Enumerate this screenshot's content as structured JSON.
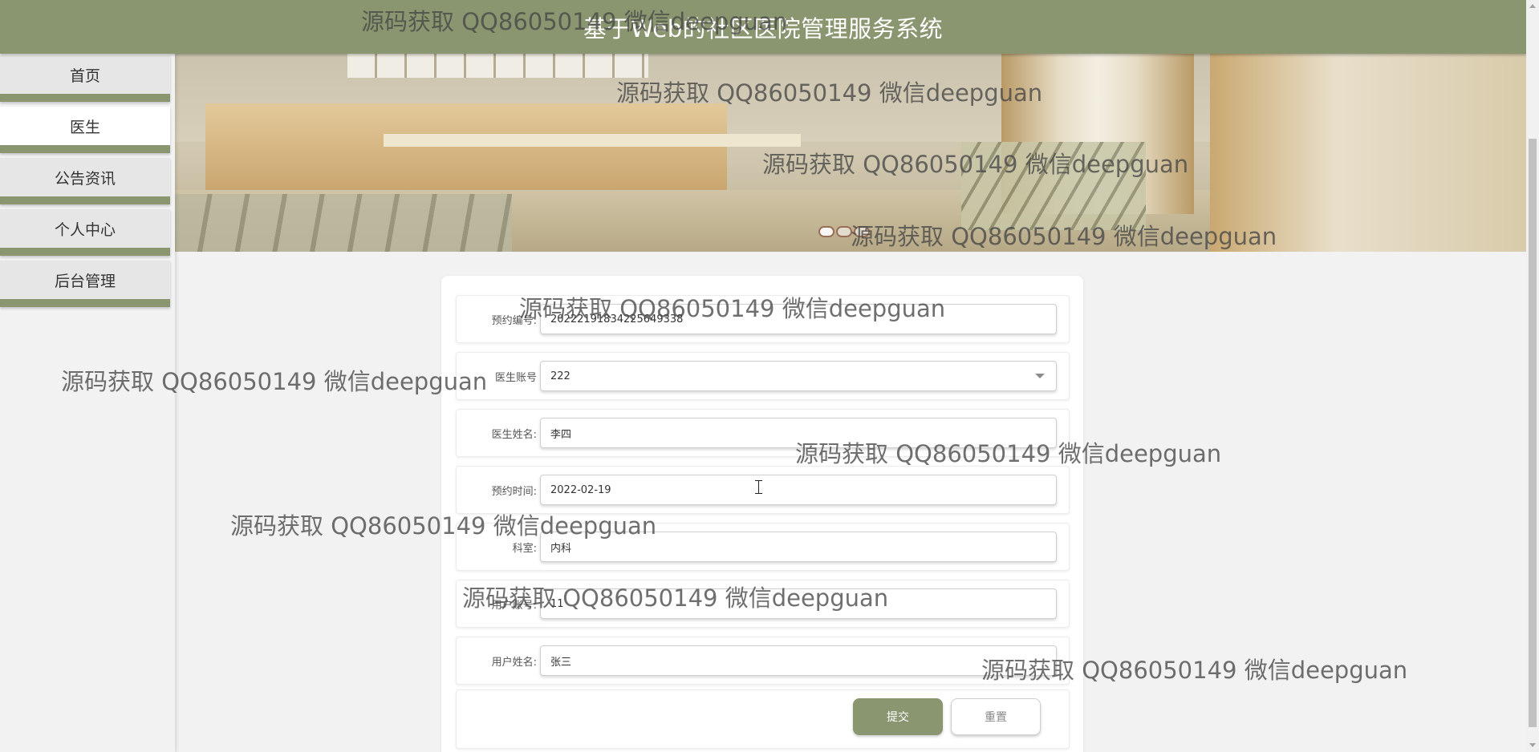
{
  "header": {
    "title": "基于Web的社区医院管理服务系统"
  },
  "sidebar": {
    "items": [
      {
        "label": "首页",
        "active": false
      },
      {
        "label": "医生",
        "active": true
      },
      {
        "label": "公告资讯",
        "active": false
      },
      {
        "label": "个人中心",
        "active": false
      },
      {
        "label": "后台管理",
        "active": false
      }
    ]
  },
  "form": {
    "fields": [
      {
        "label": "预约编号:",
        "value": "20222191834225649338"
      },
      {
        "label": "医生账号",
        "value": "222",
        "type": "select"
      },
      {
        "label": "医生姓名:",
        "value": "李四"
      },
      {
        "label": "预约时间:",
        "value": "2022-02-19"
      },
      {
        "label": "科室:",
        "value": "内科"
      },
      {
        "label": "用户账号:",
        "value": "11"
      },
      {
        "label": "用户姓名:",
        "value": "张三"
      }
    ],
    "submit_label": "提交",
    "reset_label": "重置"
  },
  "watermark": {
    "text": "源码获取 QQ86050149 微信deepguan"
  },
  "colors": {
    "accent": "#8a9670",
    "background": "#f2f2f2",
    "card": "#ffffff"
  },
  "icons": {
    "select_caret": "chevron-down-icon",
    "cursor": "text-cursor-icon"
  }
}
